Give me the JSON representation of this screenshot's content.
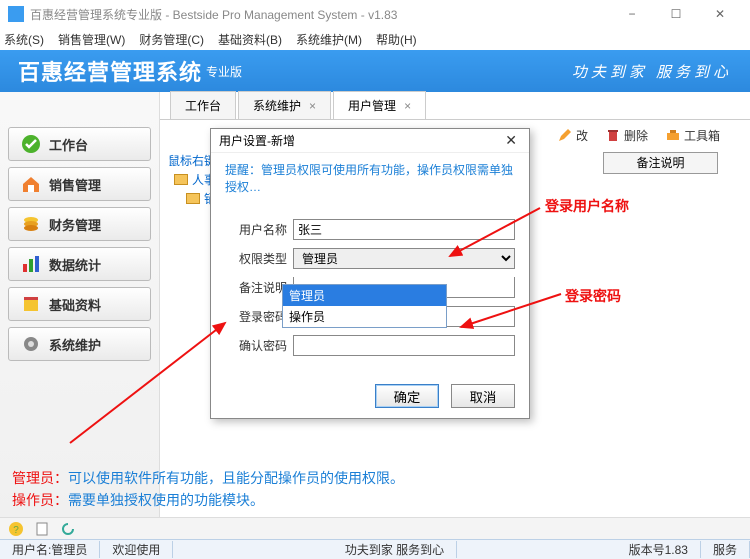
{
  "window": {
    "title": "百惠经营管理系统专业版 - Bestside Pro Management System - v1.83"
  },
  "menu": [
    "系统(S)",
    "销售管理(W)",
    "财务管理(C)",
    "基础资料(B)",
    "系统维护(M)",
    "帮助(H)"
  ],
  "brand": {
    "title": "百惠经营管理系统",
    "edition": "专业版",
    "slogan": "功夫到家 服务到心"
  },
  "sidebar": [
    {
      "label": "工作台"
    },
    {
      "label": "销售管理"
    },
    {
      "label": "财务管理"
    },
    {
      "label": "数据统计"
    },
    {
      "label": "基础资料"
    },
    {
      "label": "系统维护"
    }
  ],
  "tabs": [
    {
      "label": "工作台",
      "close": false
    },
    {
      "label": "系统维护",
      "close": true
    },
    {
      "label": "用户管理",
      "close": true,
      "active": true
    }
  ],
  "toolbar": {
    "modify": "改",
    "delete": "删除",
    "tools": "工具箱"
  },
  "note_header": "备注说明",
  "tree": {
    "root": "鼠标右键",
    "n1": "人事",
    "n2": "销售"
  },
  "dialog": {
    "title": "用户设置-新增",
    "hint": "提醒：管理员权限可使用所有功能，操作员权限需单独授权…",
    "labels": {
      "username": "用户名称",
      "role": "权限类型",
      "note": "备注说明",
      "pwd": "登录密码",
      "pwd2": "确认密码"
    },
    "values": {
      "username": "张三",
      "role": "管理员"
    },
    "options": [
      "管理员",
      "操作员"
    ],
    "ok": "确定",
    "cancel": "取消"
  },
  "annotations": {
    "username": "登录用户名称",
    "password": "登录密码"
  },
  "footnotes": {
    "l1a": "管理员：",
    "l1b": "可以使用软件所有功能，且能分配操作员的使用权限。",
    "l2a": "操作员：",
    "l2b": "需要单独授权使用的功能模块。"
  },
  "status": {
    "user_label": "用户名:",
    "user": "管理员",
    "welcome": "欢迎使用",
    "center": "功夫到家 服务到心",
    "version": "版本号1.83",
    "service": "服务"
  }
}
